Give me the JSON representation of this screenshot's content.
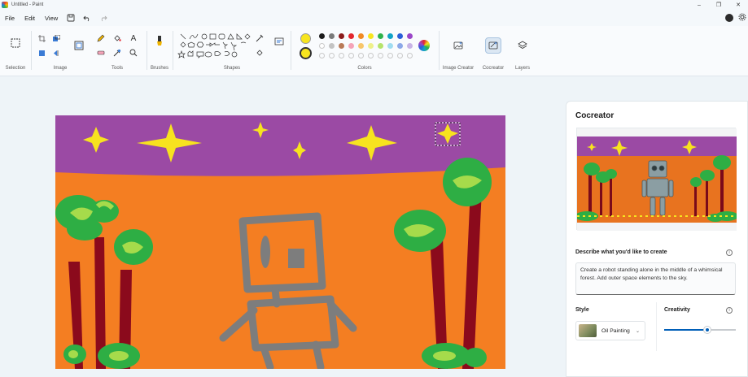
{
  "window": {
    "title": "Untitled - Paint"
  },
  "menu": {
    "file": "File",
    "edit": "Edit",
    "view": "View"
  },
  "ribbon": {
    "groups": {
      "selection": "Selection",
      "image": "Image",
      "tools": "Tools",
      "brushes": "Brushes",
      "shapes": "Shapes",
      "colors": "Colors",
      "image_creator": "Image Creator",
      "cocreator": "Cocreator",
      "layers": "Layers"
    },
    "colors": {
      "primary": "#f7e51f",
      "secondary": "#f7e51f",
      "palette_row1": [
        "#1b1b1b",
        "#7a7a7a",
        "#8b1a1a",
        "#e3262e",
        "#f08a24",
        "#f7e51f",
        "#2fb24c",
        "#11a3c7",
        "#2b5fd9",
        "#9b46c8"
      ],
      "palette_row2": [
        "#ffffff",
        "#c3c3c3",
        "#b97a57",
        "#f5a3b8",
        "#f7c66a",
        "#eef08a",
        "#b5e36b",
        "#9fdcf1",
        "#8ca8e8",
        "#c8b4e6"
      ]
    }
  },
  "cocreator": {
    "title": "Cocreator",
    "prompt_label": "Describe what you'd like to create",
    "prompt_text": "Create a robot standing alone in the middle of a whimsical forest. Add outer space elements to the sky.",
    "style_label": "Style",
    "style_value": "Oil Painting",
    "creativity_label": "Creativity",
    "creativity_level": 0.6
  }
}
